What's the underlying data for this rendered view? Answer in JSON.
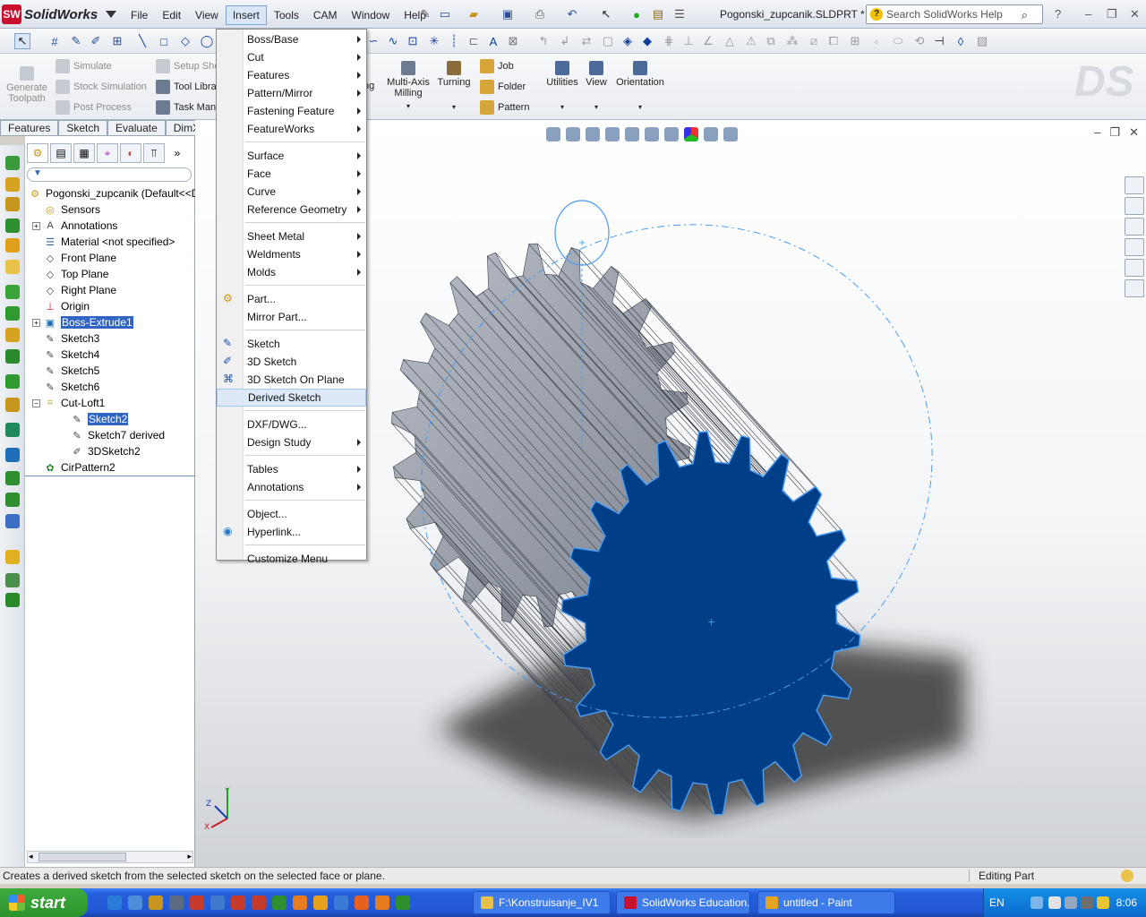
{
  "app": {
    "name": "SolidWorks",
    "doc_title": "Pogonski_zupcanik.SLDPRT *",
    "help_search_placeholder": "Search SolidWorks Help"
  },
  "menubar": [
    "File",
    "Edit",
    "View",
    "Insert",
    "Tools",
    "CAM",
    "Window",
    "Help"
  ],
  "command_manager": {
    "left_buttons": [
      {
        "label": "Generate Toolpath",
        "icon": "generate-toolpath-icon",
        "disabled": true
      }
    ],
    "left_list_a": [
      {
        "label": "Simulate",
        "icon": "simulate-icon",
        "disabled": true
      },
      {
        "label": "Stock Simulation",
        "icon": "stock-simulation-icon",
        "disabled": true
      },
      {
        "label": "Post Process",
        "icon": "post-process-icon",
        "disabled": true
      }
    ],
    "left_list_b": [
      {
        "label": "Setup She",
        "icon": "setup-sheet-icon",
        "disabled": true
      },
      {
        "label": "Tool Libra",
        "icon": "tool-library-icon",
        "disabled": false
      },
      {
        "label": "Task Man",
        "icon": "task-manager-icon",
        "disabled": false
      }
    ],
    "right_buttons": [
      {
        "label": "ng",
        "icon": ""
      },
      {
        "label": "Multi-Axis Milling",
        "icon": "multi-axis-milling-icon"
      },
      {
        "label": "Turning",
        "icon": "turning-icon"
      }
    ],
    "list_c": [
      {
        "label": "Job",
        "icon": "job-icon"
      },
      {
        "label": "Folder",
        "icon": "folder-icon"
      },
      {
        "label": "Pattern",
        "icon": "pattern-icon"
      }
    ],
    "big_buttons": [
      {
        "label": "Utilities",
        "icon": "utilities-icon"
      },
      {
        "label": "View",
        "icon": "view-icon"
      },
      {
        "label": "Orientation",
        "icon": "orientation-icon"
      }
    ]
  },
  "tabs": [
    "Features",
    "Sketch",
    "Evaluate",
    "DimXper"
  ],
  "feature_tree": {
    "root": "Pogonski_zupcanik  (Default<<De",
    "items": [
      {
        "label": "Sensors",
        "icon": "sensors-icon",
        "indent": 0,
        "exp": false,
        "sel": false
      },
      {
        "label": "Annotations",
        "icon": "annotations-icon",
        "indent": 0,
        "exp": true,
        "sel": false
      },
      {
        "label": "Material <not specified>",
        "icon": "material-icon",
        "indent": 0,
        "exp": false,
        "sel": false
      },
      {
        "label": "Front Plane",
        "icon": "plane-icon",
        "indent": 0,
        "exp": false,
        "sel": false
      },
      {
        "label": "Top Plane",
        "icon": "plane-icon",
        "indent": 0,
        "exp": false,
        "sel": false
      },
      {
        "label": "Right Plane",
        "icon": "plane-icon",
        "indent": 0,
        "exp": false,
        "sel": false
      },
      {
        "label": "Origin",
        "icon": "origin-icon",
        "indent": 0,
        "exp": false,
        "sel": false
      },
      {
        "label": "Boss-Extrude1",
        "icon": "boss-extrude-icon",
        "indent": 0,
        "exp": true,
        "sel": true
      },
      {
        "label": "Sketch3",
        "icon": "sketch-icon",
        "indent": 0,
        "exp": false,
        "sel": false
      },
      {
        "label": "Sketch4",
        "icon": "sketch-icon",
        "indent": 0,
        "exp": false,
        "sel": false
      },
      {
        "label": "Sketch5",
        "icon": "sketch-icon",
        "indent": 0,
        "exp": false,
        "sel": false
      },
      {
        "label": "Sketch6",
        "icon": "sketch-icon",
        "indent": 0,
        "exp": false,
        "sel": false
      },
      {
        "label": "Cut-Loft1",
        "icon": "cut-loft-icon",
        "indent": 0,
        "exp": true,
        "sel": false
      },
      {
        "label": "Sketch2",
        "icon": "sketch-icon",
        "indent": 1,
        "exp": false,
        "sel": true
      },
      {
        "label": "Sketch7 derived",
        "icon": "sketch-icon",
        "indent": 1,
        "exp": false,
        "sel": false
      },
      {
        "label": "3DSketch2",
        "icon": "3d-sketch-icon",
        "indent": 1,
        "exp": false,
        "sel": false
      },
      {
        "label": "CirPattern2",
        "icon": "circular-pattern-icon",
        "indent": 0,
        "exp": false,
        "sel": false
      }
    ]
  },
  "insert_menu": [
    {
      "label": "Boss/Base",
      "submenu": true,
      "icon": ""
    },
    {
      "label": "Cut",
      "submenu": true,
      "icon": ""
    },
    {
      "label": "Features",
      "submenu": true,
      "icon": ""
    },
    {
      "label": "Pattern/Mirror",
      "submenu": true,
      "icon": ""
    },
    {
      "label": "Fastening Feature",
      "submenu": true,
      "icon": ""
    },
    {
      "label": "FeatureWorks",
      "submenu": true,
      "icon": ""
    },
    {
      "sep": true
    },
    {
      "label": "Surface",
      "submenu": true,
      "icon": ""
    },
    {
      "label": "Face",
      "submenu": true,
      "icon": ""
    },
    {
      "label": "Curve",
      "submenu": true,
      "icon": ""
    },
    {
      "label": "Reference Geometry",
      "submenu": true,
      "icon": ""
    },
    {
      "sep": true
    },
    {
      "label": "Sheet Metal",
      "submenu": true,
      "icon": ""
    },
    {
      "label": "Weldments",
      "submenu": true,
      "icon": ""
    },
    {
      "label": "Molds",
      "submenu": true,
      "icon": ""
    },
    {
      "sep": true
    },
    {
      "label": "Part...",
      "submenu": false,
      "icon": "part-icon"
    },
    {
      "label": "Mirror Part...",
      "submenu": false,
      "icon": ""
    },
    {
      "sep": true
    },
    {
      "label": "Sketch",
      "submenu": false,
      "icon": "sketch-icon"
    },
    {
      "label": "3D Sketch",
      "submenu": false,
      "icon": "3d-sketch-icon"
    },
    {
      "label": "3D Sketch On Plane",
      "submenu": false,
      "icon": "3d-sketch-on-plane-icon"
    },
    {
      "label": "Derived Sketch",
      "submenu": false,
      "icon": "",
      "highlight": true
    },
    {
      "sep": true
    },
    {
      "label": "DXF/DWG...",
      "submenu": false,
      "icon": ""
    },
    {
      "label": "Design Study",
      "submenu": true,
      "icon": ""
    },
    {
      "sep": true
    },
    {
      "label": "Tables",
      "submenu": true,
      "icon": ""
    },
    {
      "label": "Annotations",
      "submenu": true,
      "icon": ""
    },
    {
      "sep": true
    },
    {
      "label": "Object...",
      "submenu": false,
      "icon": ""
    },
    {
      "label": "Hyperlink...",
      "submenu": false,
      "icon": "hyperlink-icon"
    },
    {
      "sep": true
    },
    {
      "label": "Customize Menu",
      "submenu": false,
      "icon": ""
    }
  ],
  "status": {
    "message": "Creates a derived sketch from the selected sketch on the selected face or plane.",
    "mode": "Editing Part"
  },
  "triad": {
    "x": "X",
    "y": "Y",
    "z": "Z"
  },
  "taskbar": {
    "start": "start",
    "tasks": [
      {
        "label": "F:\\Konstruisanje_IV1",
        "icon": "folder-icon"
      },
      {
        "label": "SolidWorks Education...",
        "icon": "solidworks-icon"
      },
      {
        "label": "untitled - Paint",
        "icon": "paint-icon"
      }
    ],
    "lang": "EN",
    "clock": "8:06"
  },
  "colors": {
    "gear_face": "#003f87",
    "gear_side": "#8e949f",
    "sketch_line": "#4a9cf0",
    "selection": "#3165c4"
  }
}
